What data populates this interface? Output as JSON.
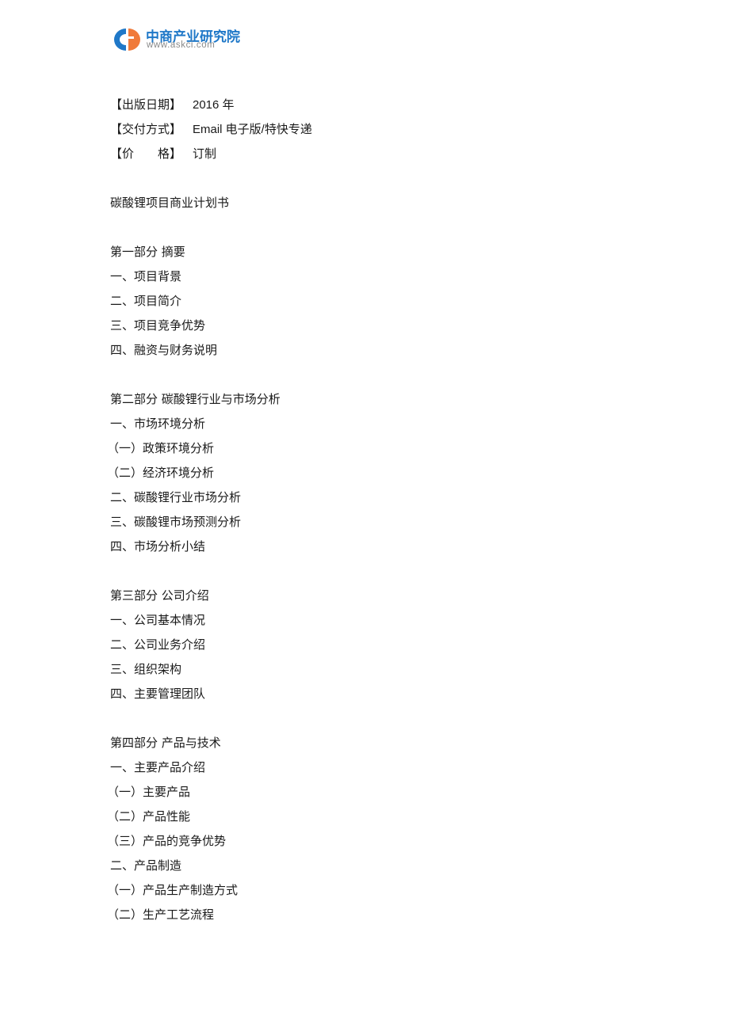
{
  "header": {
    "logo_title": "中商产业研究院",
    "logo_url": "www.askci.com",
    "colors": {
      "brand_blue": "#1f78c8",
      "brand_orange": "#f07a3a",
      "url_gray": "#8a8a8a"
    }
  },
  "meta": [
    {
      "key": "【出版日期】",
      "value": "2016 年"
    },
    {
      "key": "【交付方式】",
      "value": "Email 电子版/特快专递"
    },
    {
      "key": "【价　　格】",
      "value": "订制"
    }
  ],
  "document": {
    "title": "碳酸锂项目商业计划书",
    "sections": [
      {
        "heading": "第一部分  摘要",
        "items": [
          "一、项目背景",
          "二、项目简介",
          "三、项目竞争优势",
          "四、融资与财务说明"
        ]
      },
      {
        "heading": "第二部分  碳酸锂行业与市场分析",
        "items": [
          "一、市场环境分析",
          "（一）政策环境分析",
          "（二）经济环境分析",
          "二、碳酸锂行业市场分析",
          "三、碳酸锂市场预测分析",
          "四、市场分析小结"
        ]
      },
      {
        "heading": "第三部分  公司介绍",
        "items": [
          "一、公司基本情况",
          "二、公司业务介绍",
          "三、组织架构",
          "四、主要管理团队"
        ]
      },
      {
        "heading": "第四部分  产品与技术",
        "items": [
          "一、主要产品介绍",
          "（一）主要产品",
          "（二）产品性能",
          "（三）产品的竞争优势",
          "二、产品制造",
          "（一）产品生产制造方式",
          "（二）生产工艺流程"
        ]
      }
    ]
  }
}
